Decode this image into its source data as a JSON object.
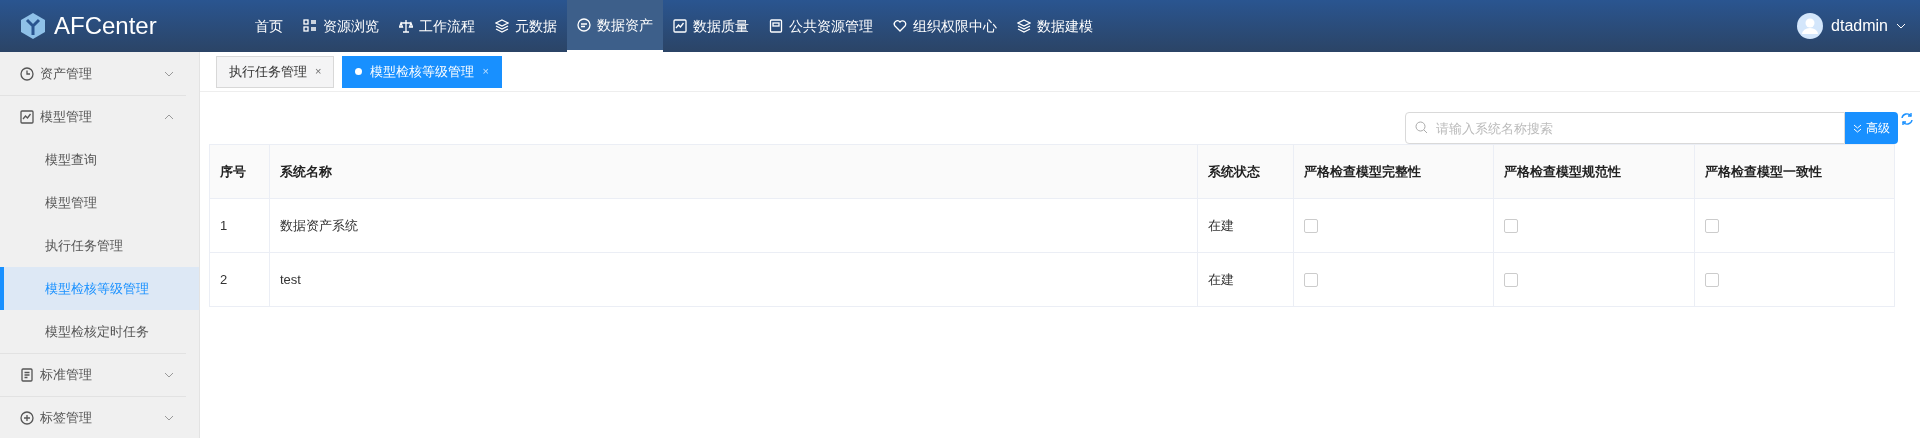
{
  "header": {
    "logo": "AFCenter",
    "nav": [
      {
        "label": "首页",
        "kind": "plain",
        "selected": false
      },
      {
        "label": "资源浏览",
        "kind": "grid",
        "selected": false
      },
      {
        "label": "工作流程",
        "kind": "flow",
        "selected": false
      },
      {
        "label": "元数据",
        "kind": "layers",
        "selected": false
      },
      {
        "label": "数据资产",
        "kind": "chat",
        "selected": true
      },
      {
        "label": "数据质量",
        "kind": "chart",
        "selected": false
      },
      {
        "label": "公共资源管理",
        "kind": "disk",
        "selected": false
      },
      {
        "label": "组织权限中心",
        "kind": "heart",
        "selected": false
      },
      {
        "label": "数据建模",
        "kind": "layers",
        "selected": false
      }
    ],
    "user": "dtadmin"
  },
  "sidebar": {
    "items": [
      {
        "label": "资产管理",
        "kind": "clock",
        "expanded": false
      },
      {
        "label": "模型管理",
        "kind": "chart",
        "expanded": true,
        "children": [
          {
            "label": "模型查询",
            "selected": false
          },
          {
            "label": "模型管理",
            "selected": false
          },
          {
            "label": "执行任务管理",
            "selected": false
          },
          {
            "label": "模型检核等级管理",
            "selected": true
          },
          {
            "label": "模型检核定时任务",
            "selected": false
          }
        ]
      },
      {
        "label": "标准管理",
        "kind": "doc",
        "expanded": false
      },
      {
        "label": "标签管理",
        "kind": "plus",
        "expanded": false
      }
    ]
  },
  "tabs": [
    {
      "label": "执行任务管理",
      "close": "×",
      "selected": false
    },
    {
      "label": "模型检核等级管理",
      "close": "×",
      "selected": true
    }
  ],
  "search": {
    "placeholder": "请输入系统名称搜索",
    "button": "高级"
  },
  "table": {
    "columns": [
      "序号",
      "系统名称",
      "系统状态",
      "严格检查模型完整性",
      "严格检查模型规范性",
      "严格检查模型一致性"
    ],
    "rows": [
      {
        "index": "1",
        "name": "数据资产系统",
        "status": "在建",
        "checks": [
          false,
          false,
          false
        ]
      },
      {
        "index": "2",
        "name": "test",
        "status": "在建",
        "checks": [
          false,
          false,
          false
        ]
      }
    ]
  }
}
